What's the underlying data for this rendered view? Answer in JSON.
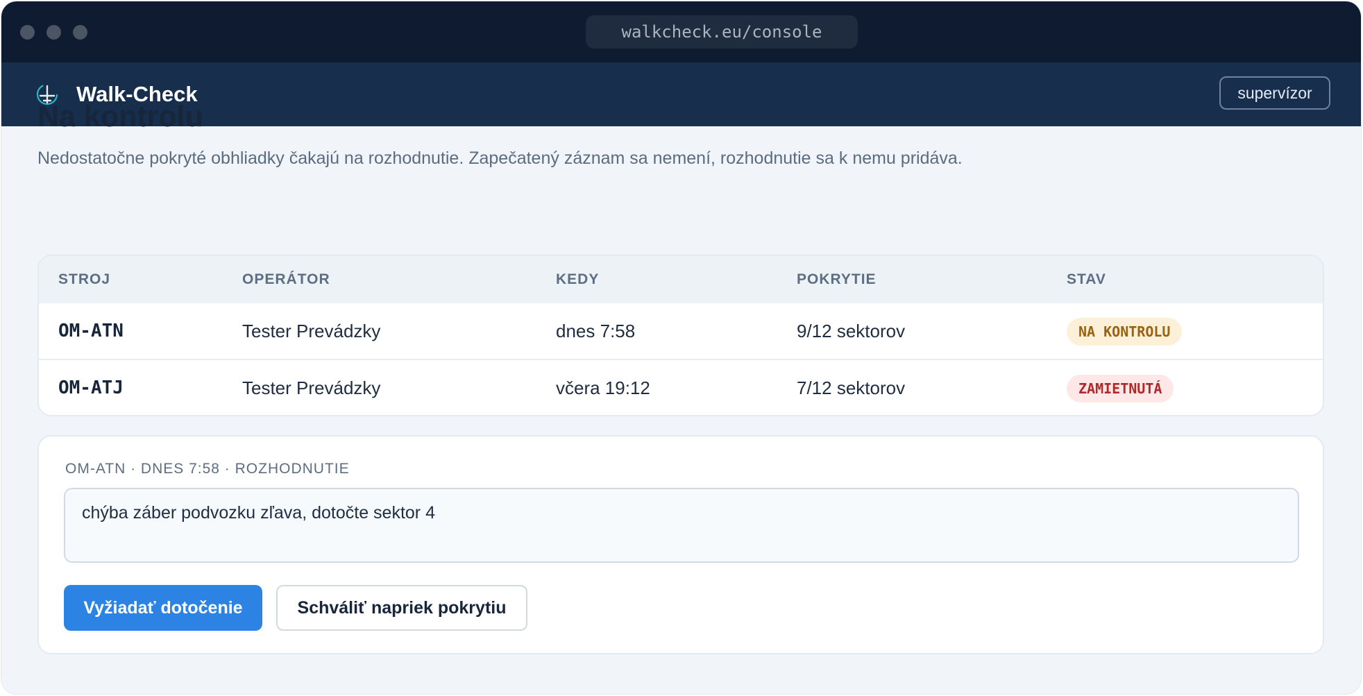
{
  "browser": {
    "url": "walkcheck.eu/console"
  },
  "app": {
    "name": "Walk-Check",
    "logo_icon": "aircraft-target-icon",
    "role_button": "supervízor"
  },
  "page": {
    "title": "Na kontrolu",
    "subtitle": "Nedostatočne pokryté obhliadky čakajú na rozhodnutie. Zapečatený záznam sa nemení, rozhodnutie sa k nemu pridáva."
  },
  "table": {
    "columns": [
      "STROJ",
      "OPERÁTOR",
      "KEDY",
      "POKRYTIE",
      "STAV"
    ],
    "rows": [
      {
        "aircraft": "OM-ATN",
        "operator": "Tester Prevádzky",
        "when": "dnes 7:58",
        "coverage": "9/12 sektorov",
        "status": "NA KONTROLU",
        "status_color": "#9a6310"
      },
      {
        "aircraft": "OM-ATJ",
        "operator": "Tester Prevádzky",
        "when": "včera 19:12",
        "coverage": "7/12 sektorov",
        "status": "ZAMIETNUTÁ",
        "status_color": "#b02a2a"
      }
    ]
  },
  "decision": {
    "label": "OM-ATN · DNES 7:58 · ROZHODNUTIE",
    "note_value": "chýba záber podvozku zľava, dotočte sektor 4",
    "request_button": "Vyžiadať dotočenie",
    "approve_button": "Schváliť napriek pokrytiu"
  },
  "colors": {
    "accent": "#2d83e3",
    "appbar": "#172e4c",
    "titlebar": "#0f1b30"
  }
}
